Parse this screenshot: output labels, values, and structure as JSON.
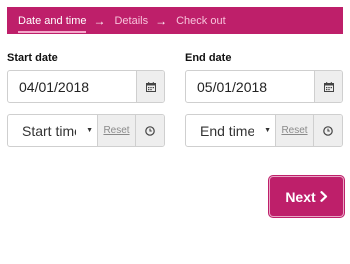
{
  "stepper": {
    "steps": [
      {
        "label": "Date and time",
        "active": true
      },
      {
        "label": "Details",
        "active": false
      },
      {
        "label": "Check out",
        "active": false
      }
    ],
    "separator": "→"
  },
  "start": {
    "label": "Start date",
    "date_value": "04/01/2018",
    "date_icon": "calendar-icon",
    "time_placeholder": "Start time",
    "reset_label": "Reset",
    "time_icon": "clock-icon"
  },
  "end": {
    "label": "End date",
    "date_value": "05/01/2018",
    "date_icon": "calendar-icon",
    "time_placeholder": "End time",
    "reset_label": "Reset",
    "time_icon": "clock-icon"
  },
  "actions": {
    "next_label": "Next",
    "next_icon": "chevron-right-icon"
  },
  "colors": {
    "brand": "#be1f6a",
    "addon_bg": "#eeeeee",
    "border": "#cfcfcf"
  }
}
